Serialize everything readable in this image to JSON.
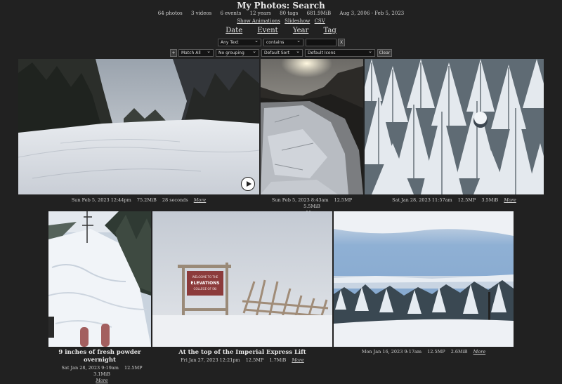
{
  "page": {
    "title": "My Photos: Search",
    "stats": [
      "64 photos",
      "3 videos",
      "6 events",
      "12 years",
      "80 tags",
      "681.9MiB",
      "Aug 3, 2006 - Feb 5, 2023"
    ],
    "links": [
      "Show Animations",
      "Slideshow",
      "CSV"
    ],
    "tabs": [
      "Date",
      "Event",
      "Year",
      "Tag"
    ]
  },
  "search": {
    "field": "Any Text",
    "op": "contains",
    "value": "",
    "remove": "X",
    "add": "+",
    "match": "Match All",
    "grouping": "No grouping",
    "sort": "Default Sort",
    "icons": "Default Icons",
    "clear": "Clear"
  },
  "photos": [
    {
      "date": "Sun Feb 5, 2023 12:44pm",
      "size": "75.2MiB",
      "extra": "28 seconds",
      "more": "More",
      "video": true
    },
    {
      "date": "Sun Feb 5, 2023 8:43am",
      "res": "12.5MP",
      "size": "5.5MiB",
      "more": "More"
    },
    {
      "date": "Sat Jan 28, 2023 11:57am",
      "res": "12.5MP",
      "size": "3.5MiB",
      "more": "More"
    },
    {
      "title": "9 inches of fresh powder overnight",
      "date": "Sat Jan 28, 2023 9:19am",
      "res": "12.5MP",
      "size": "3.1MiB",
      "more": "More"
    },
    {
      "title": "At the top of the Imperial Express Lift",
      "date": "Fri Jan 27, 2023 12:21pm",
      "res": "12.5MP",
      "size": "1.7MiB",
      "more": "More"
    },
    {
      "date": "Mon Jan 16, 2023 9:17am",
      "res": "12.5MP",
      "size": "2.6MiB",
      "more": "More"
    }
  ],
  "sign": {
    "line1": "WELCOME TO THE",
    "line2": "ELEVATIONS",
    "line3": "COLLEGE OF SKI"
  }
}
